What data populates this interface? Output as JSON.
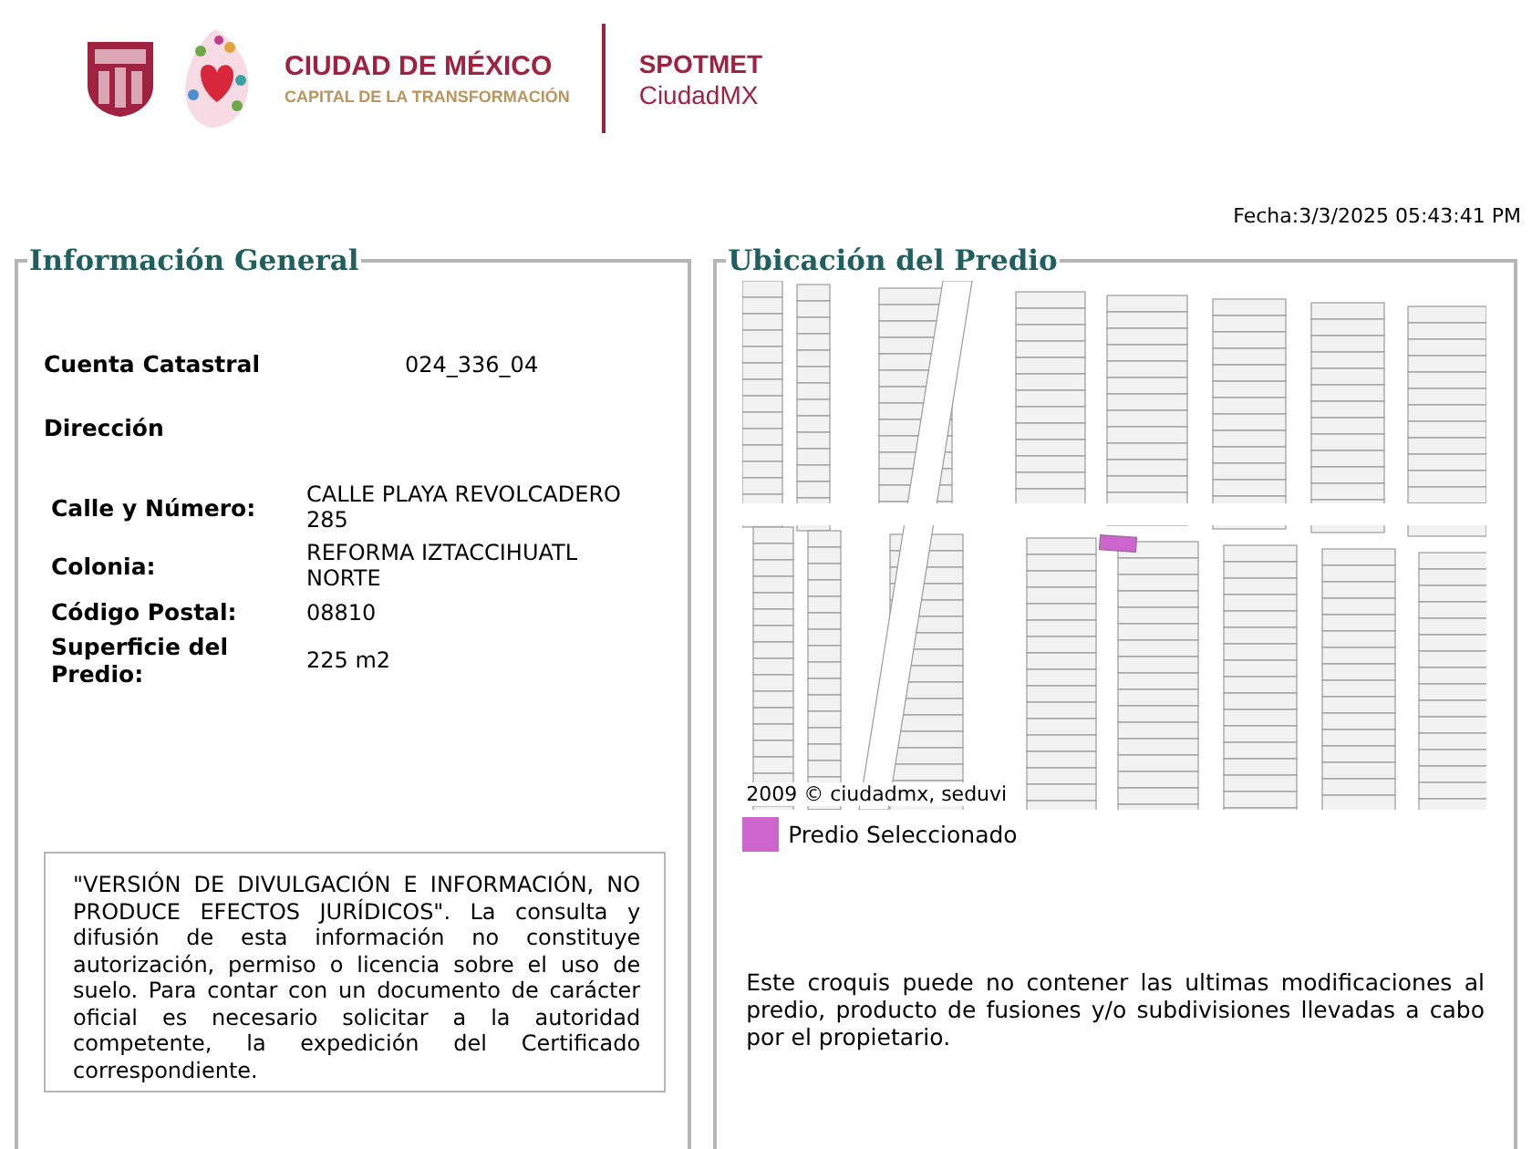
{
  "header": {
    "brand_title": "CIUDAD DE MÉXICO",
    "brand_subtitle": "CAPITAL DE LA TRANSFORMACIÓN",
    "app_name": "SPOTMET",
    "app_subtitle": "CiudadMX"
  },
  "date": "Fecha:3/3/2025 05:43:41 PM",
  "general_info": {
    "title": "Información General",
    "account": {
      "label": "Cuenta Catastral",
      "value": "024_336_04"
    },
    "address_heading": "Dirección",
    "address_fields": [
      {
        "label": "Calle y Número:",
        "value": "CALLE PLAYA REVOLCADERO 285"
      },
      {
        "label": "Colonia:",
        "value": "REFORMA IZTACCIHUATL NORTE"
      },
      {
        "label": "Código Postal:",
        "value": "08810"
      },
      {
        "label": "Superficie del Predio:",
        "value": "225 m2"
      }
    ],
    "disclaimer": "\"VERSIÓN DE DIVULGACIÓN E INFORMACIÓN, NO PRODUCE EFECTOS JURÍDICOS\". La consulta y difusión de esta información no constituye autorización, permiso o licencia sobre el uso de suelo. Para contar con un documento de carácter oficial es necesario solicitar a la autoridad competente, la expedición del Certificado correspondiente."
  },
  "location": {
    "title": "Ubicación del Predio",
    "map_credit": "2009 © ciudadmx, seduvi",
    "legend": [
      {
        "label": "Predio Seleccionado",
        "color": "#cc66cc"
      }
    ],
    "note": "Este croquis puede no contener las ultimas modificaciones al predio, producto de fusiones y/o subdivisiones llevadas a cabo por el propietario."
  }
}
